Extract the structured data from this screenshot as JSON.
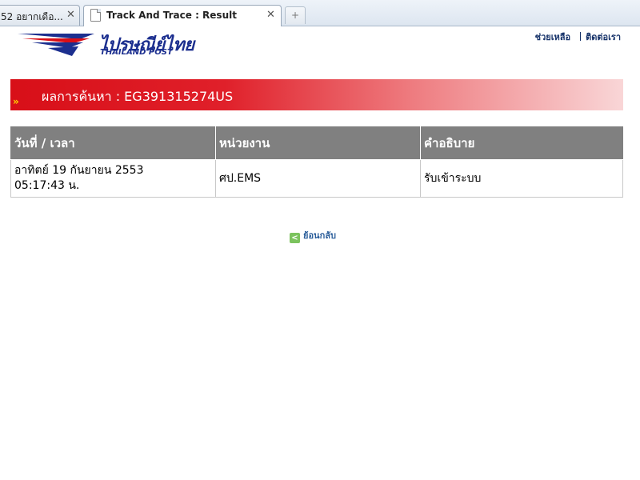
{
  "browser": {
    "tabs": [
      {
        "label": "52 อยากเดือ...",
        "close": "✕"
      },
      {
        "label": "Track And Trace : Result",
        "close": "✕"
      }
    ],
    "new_tab": "+"
  },
  "header": {
    "logo_th": "ไปรษณีย์ไทย",
    "logo_en": "THAILAND POST",
    "links": [
      "ช่วยเหลือ",
      "ติดต่อเรา"
    ]
  },
  "banner": {
    "title": "ผลการค้นหา  :  EG391315274US"
  },
  "table": {
    "headers": [
      "วันที่ / เวลา",
      "หน่วยงาน",
      "คำอธิบาย"
    ],
    "rows": [
      {
        "date_line1": "อาทิตย์ 19 กันยายน 2553",
        "date_line2": "05:17:43 น.",
        "office": "ศป.EMS",
        "description": "รับเข้าระบบ"
      }
    ]
  },
  "back_link": "ย้อนกลับ",
  "colors": {
    "banner_red": "#d80f18",
    "header_gray": "#808080",
    "link_blue": "#17336a"
  }
}
